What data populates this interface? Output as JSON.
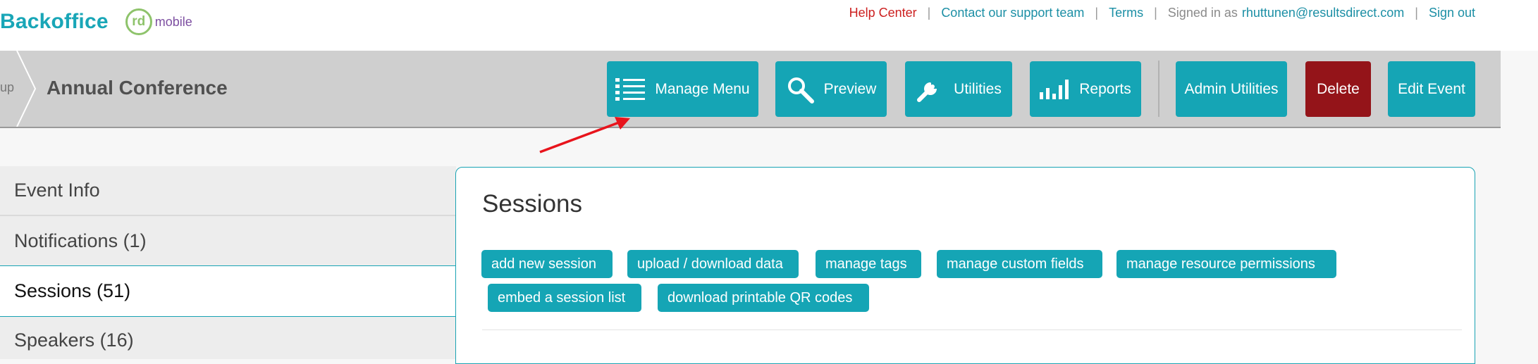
{
  "brand": {
    "name": "Backoffice",
    "badge": "rd",
    "badge_suffix": "mobile"
  },
  "toplinks": {
    "help": "Help Center",
    "support": "Contact our support team",
    "terms": "Terms",
    "signed_prefix": "Signed in as",
    "user_email": "rhuttunen@resultsdirect.com",
    "signout": "Sign out",
    "separator": "|"
  },
  "breadcrumb": {
    "prev": "up",
    "current": "Annual Conference"
  },
  "toolbar": {
    "manage_menu": "Manage Menu",
    "preview": "Preview",
    "utilities": "Utilities",
    "reports": "Reports",
    "admin_utilities": "Admin Utilities",
    "delete": "Delete",
    "edit_event": "Edit Event"
  },
  "sidebar": {
    "items": [
      {
        "label": "Event Info"
      },
      {
        "label": "Notifications (1)"
      },
      {
        "label": "Sessions (51)"
      },
      {
        "label": "Speakers (16)"
      }
    ]
  },
  "main": {
    "title": "Sessions",
    "actions": [
      "add new session",
      "upload / download data",
      "manage tags",
      "manage custom fields",
      "manage resource permissions",
      "embed a session list",
      "download printable QR codes"
    ]
  },
  "colors": {
    "teal": "#15a5b5",
    "delete_red": "#941419",
    "help_red": "#cc1f1f",
    "annotation_arrow": "#e8141c"
  }
}
